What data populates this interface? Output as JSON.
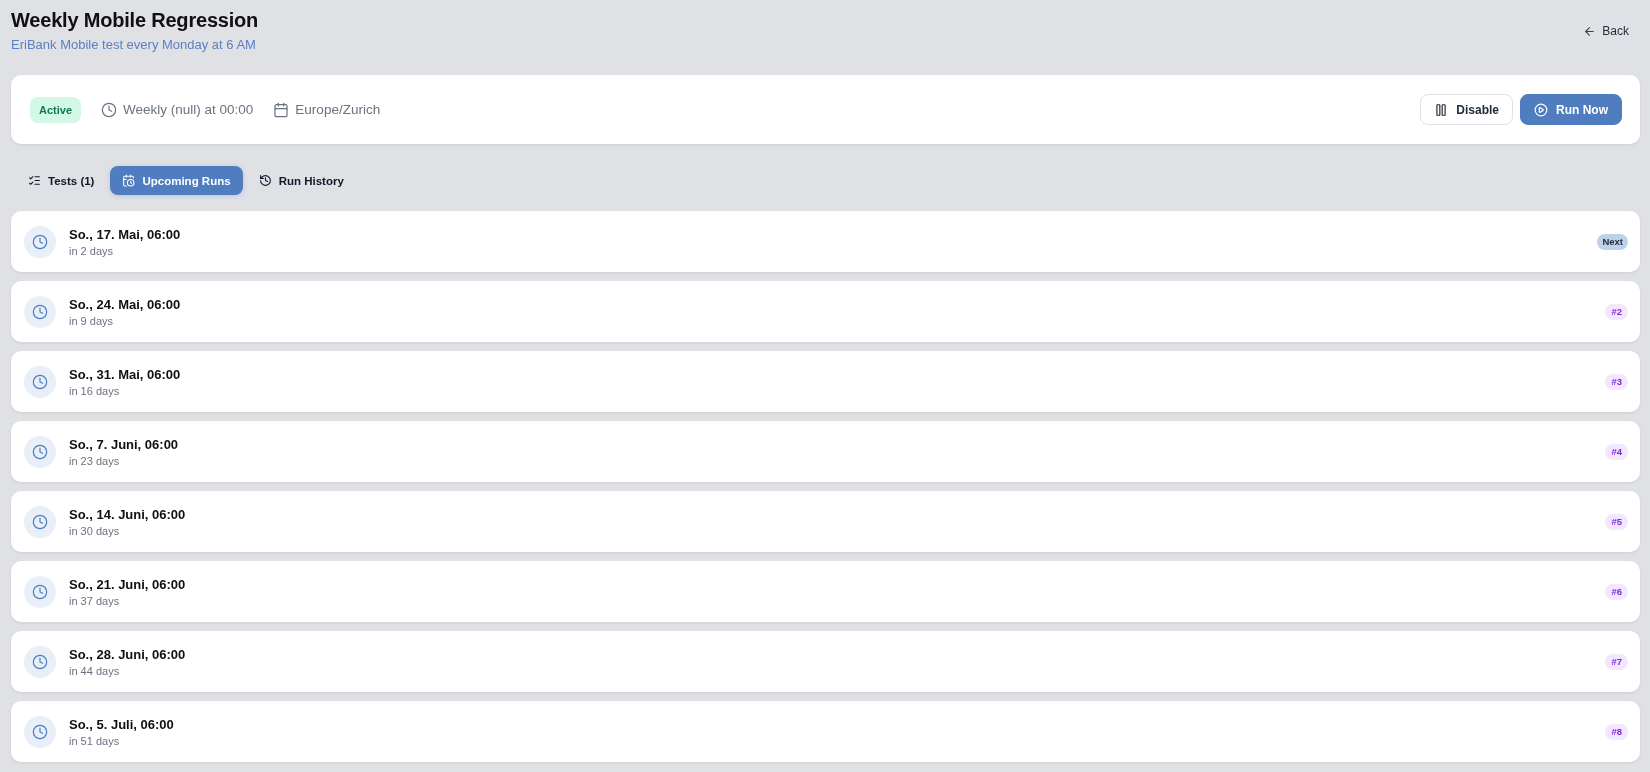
{
  "header": {
    "title": "Weekly Mobile Regression",
    "subtitle": "EriBank Mobile test every Monday at 6 AM",
    "back": "Back"
  },
  "summary": {
    "status": "Active",
    "schedule": "Weekly (null) at 00:00",
    "timezone": "Europe/Zurich",
    "buttons": [
      {
        "label": "Disable",
        "kind": "secondary"
      },
      {
        "label": "Run Now",
        "kind": "primary"
      }
    ]
  },
  "tabs": [
    {
      "label": "Tests (1)",
      "selected": false
    },
    {
      "label": "Upcoming Runs",
      "selected": true
    },
    {
      "label": "Run History",
      "selected": false
    }
  ],
  "runs": [
    {
      "date": "So., 17. Mai, 06:00",
      "relative": "in 2 days",
      "badge": {
        "label": "Next",
        "kind": "next"
      }
    },
    {
      "date": "So., 24. Mai, 06:00",
      "relative": "in 9 days",
      "badge": {
        "label": "#2",
        "kind": "index"
      }
    },
    {
      "date": "So., 31. Mai, 06:00",
      "relative": "in 16 days",
      "badge": {
        "label": "#3",
        "kind": "index"
      }
    },
    {
      "date": "So., 7. Juni, 06:00",
      "relative": "in 23 days",
      "badge": {
        "label": "#4",
        "kind": "index"
      }
    },
    {
      "date": "So., 14. Juni, 06:00",
      "relative": "in 30 days",
      "badge": {
        "label": "#5",
        "kind": "index"
      }
    },
    {
      "date": "So., 21. Juni, 06:00",
      "relative": "in 37 days",
      "badge": {
        "label": "#6",
        "kind": "index"
      }
    },
    {
      "date": "So., 28. Juni, 06:00",
      "relative": "in 44 days",
      "badge": {
        "label": "#7",
        "kind": "index"
      }
    },
    {
      "date": "So., 5. Juli, 06:00",
      "relative": "in 51 days",
      "badge": {
        "label": "#8",
        "kind": "index"
      }
    }
  ]
}
